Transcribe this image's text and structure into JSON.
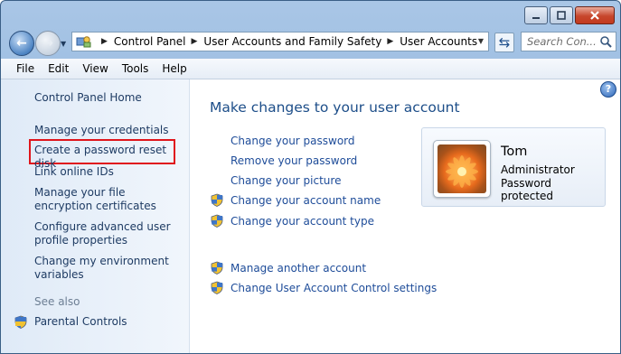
{
  "window": {
    "controls": {
      "minimize": "minimize",
      "maximize": "maximize",
      "close": "close"
    }
  },
  "address": {
    "breadcrumbs": [
      "Control Panel",
      "User Accounts and Family Safety",
      "User Accounts"
    ],
    "search_placeholder": "Search Con..."
  },
  "menu": [
    "File",
    "Edit",
    "View",
    "Tools",
    "Help"
  ],
  "sidebar": {
    "home": "Control Panel Home",
    "links": [
      "Manage your credentials",
      "Create a password reset disk",
      "Link online IDs",
      "Manage your file encryption certificates",
      "Configure advanced user profile properties",
      "Change my environment variables"
    ],
    "see_also": "See also",
    "see_also_links": [
      "Parental Controls"
    ]
  },
  "main": {
    "title": "Make changes to your user account",
    "links": [
      "Change your password",
      "Remove your password",
      "Change your picture",
      "Change your account name",
      "Change your account type"
    ],
    "other_links": [
      "Manage another account",
      "Change User Account Control settings"
    ]
  },
  "user": {
    "name": "Tom",
    "role": "Administrator",
    "status": "Password protected"
  },
  "colors": {
    "link": "#1e4c99",
    "title": "#1d4e89",
    "highlight": "#e0151b"
  },
  "icons": {
    "shield": "uac-shield-icon",
    "help": "help-icon",
    "search": "search-icon"
  }
}
